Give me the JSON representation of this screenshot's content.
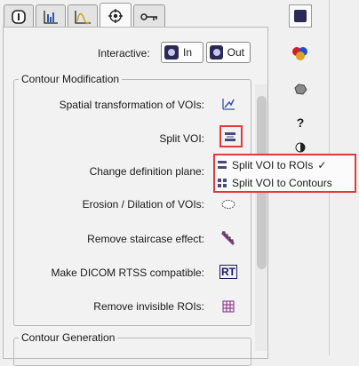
{
  "tabs": [
    {
      "icon": "info-icon"
    },
    {
      "icon": "histogram-icon"
    },
    {
      "icon": "curve-plot-icon"
    },
    {
      "icon": "target-settings-icon",
      "active": true
    },
    {
      "icon": "key-tool-icon"
    }
  ],
  "interactive": {
    "label": "Interactive:",
    "in_label": "In",
    "out_label": "Out"
  },
  "contour_modification": {
    "title": "Contour Modification",
    "rows": [
      {
        "label": "Spatial transformation of VOIs:",
        "icon": "transform-icon"
      },
      {
        "label": "Split VOI:",
        "icon": "split-voi-icon"
      },
      {
        "label": "Change definition plane:",
        "icon": "plane-icon"
      },
      {
        "label": "Erosion / Dilation of VOIs:",
        "icon": "erosion-icon"
      },
      {
        "label": "Remove staircase effect:",
        "icon": "staircase-icon"
      },
      {
        "label": "Make DICOM RTSS compatible:",
        "icon": "rt-icon",
        "icon_text": "RT"
      },
      {
        "label": "Remove invisible ROIs:",
        "icon": "grid-icon"
      }
    ]
  },
  "contour_generation": {
    "title": "Contour Generation"
  },
  "popup_menu": {
    "items": [
      {
        "label": "Split VOI to ROIs",
        "check": "✓"
      },
      {
        "label": "Split VOI to Contours",
        "check": ""
      }
    ]
  },
  "side_toolbar": {
    "help_label": "?"
  },
  "colors": {
    "highlight": "#e03a3a",
    "panel_bg": "#f2f2f2"
  }
}
